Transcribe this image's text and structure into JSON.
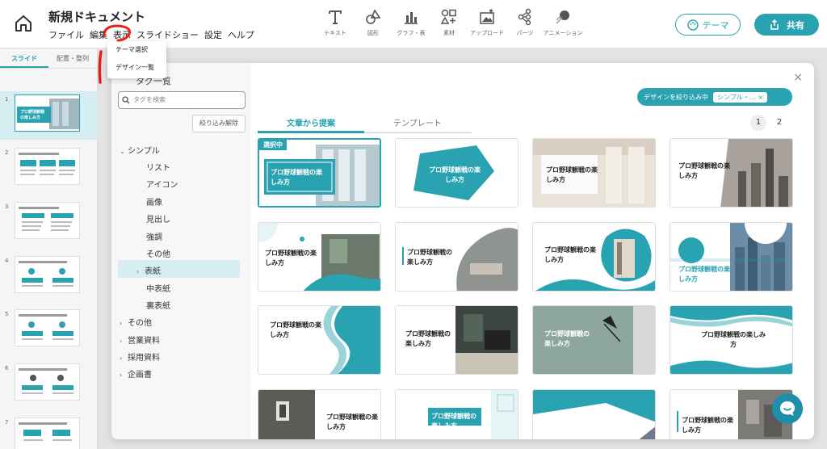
{
  "app": {
    "doc_title": "新規ドキュメント",
    "menu": [
      "ファイル",
      "編集",
      "表示",
      "スライドショー",
      "設定",
      "ヘルプ"
    ]
  },
  "toolbar": {
    "tools": [
      {
        "label": "テキスト",
        "icon": "text-icon"
      },
      {
        "label": "図形",
        "icon": "shape-icon"
      },
      {
        "label": "グラフ・表",
        "icon": "chart-icon"
      },
      {
        "label": "素材",
        "icon": "material-icon"
      },
      {
        "label": "アップロード",
        "icon": "upload-icon"
      },
      {
        "label": "パーツ",
        "icon": "parts-icon"
      },
      {
        "label": "アニメーション",
        "icon": "animation-icon"
      }
    ],
    "theme_label": "テーマ",
    "share_label": "共有"
  },
  "dropdown": {
    "items": [
      "テーマ選択",
      "デザイン一覧"
    ]
  },
  "left_panel": {
    "tabs": [
      "スライド",
      "配置・整列"
    ],
    "slide_numbers": [
      "1",
      "2",
      "3",
      "4",
      "5",
      "6",
      "7"
    ],
    "thumb_title": "プロ野球観戦の楽しみ方"
  },
  "modal": {
    "tag_title": "タグ一覧",
    "search_placeholder": "タグを検索",
    "filter_clear": "絞り込み解除",
    "tags": [
      {
        "label": "シンプル",
        "level": 0,
        "chevron": "down"
      },
      {
        "label": "リスト",
        "level": 1
      },
      {
        "label": "アイコン",
        "level": 1
      },
      {
        "label": "画像",
        "level": 1
      },
      {
        "label": "見出し",
        "level": 1
      },
      {
        "label": "強調",
        "level": 1
      },
      {
        "label": "その他",
        "level": 1
      },
      {
        "label": "表紙",
        "level": 1,
        "chevron": "right",
        "selected": true
      },
      {
        "label": "中表紙",
        "level": 1
      },
      {
        "label": "裏表紙",
        "level": 1
      },
      {
        "label": "その他",
        "level": 0,
        "chevron": "right"
      },
      {
        "label": "営業資料",
        "level": 0,
        "chevron": "right"
      },
      {
        "label": "採用資料",
        "level": 0,
        "chevron": "right"
      },
      {
        "label": "企画書",
        "level": 0,
        "chevron": "right"
      }
    ],
    "filter_chip_label": "デザインを絞り込み中",
    "filter_chip_value": "シンプル・…",
    "filter_chip_close": "×",
    "tabs": [
      "文章から提案",
      "テンプレート"
    ],
    "pages": [
      "1",
      "2"
    ],
    "selected_badge": "選択中",
    "card_title": "プロ野球観戦の楽しみ方",
    "close": "×"
  },
  "colors": {
    "accent": "#29a3b2",
    "accent_light": "#d6eef1",
    "annotation": "#e8201a"
  }
}
